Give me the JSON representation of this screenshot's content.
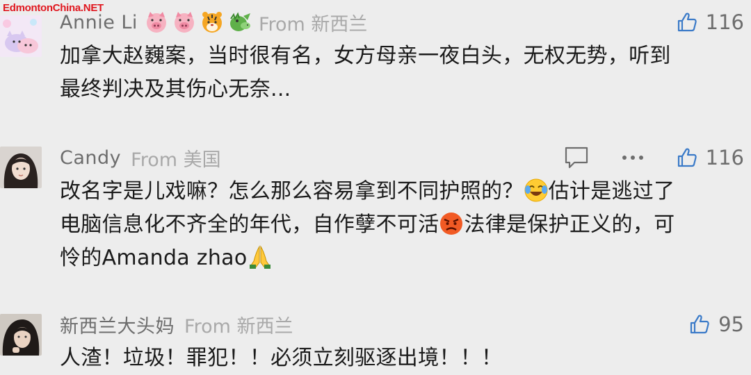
{
  "watermark": "EdmontonChina.NET",
  "comments": [
    {
      "username": "Annie Li",
      "badges": [
        "pig-emoji",
        "pig-emoji",
        "tiger-emoji",
        "dragon-emoji"
      ],
      "location": "From 新西兰",
      "likes": "116",
      "text_lines": [
        "加拿大赵巍案，当时很有名，女方母亲一夜白头，无权无势，听到",
        "最终判决及其伤心无奈..."
      ]
    },
    {
      "username": "Candy",
      "location": "From 美国",
      "likes": "116",
      "text_parts": {
        "p1": "改名字是儿戏嘛？怎么那么容易拿到不同护照的？",
        "p2": "估计是逃过了",
        "p3": "电脑信息化不齐全的年代，自作孽不可活",
        "p4": "法律是保护正义的，可",
        "p5": "怜的Amanda zhao"
      },
      "emojis": [
        "laughing-crying-emoji",
        "angry-face-emoji",
        "praying-hands-emoji"
      ]
    },
    {
      "username": "新西兰大头妈",
      "location": "From 新西兰",
      "likes": "95",
      "text": "人渣！垃圾！罪犯！！必须立刻驱逐出境！！！"
    }
  ]
}
